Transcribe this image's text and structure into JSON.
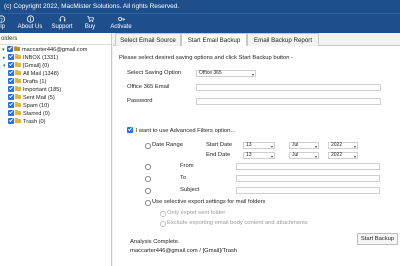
{
  "title": "(c) Copyright 2022, MacMister Solutions. All rights Reserved.",
  "toolbar": [
    {
      "label": "elp",
      "icon": "help-icon"
    },
    {
      "label": "About Us",
      "icon": "info-icon"
    },
    {
      "label": "Support",
      "icon": "support-icon"
    },
    {
      "label": "Buy",
      "icon": "cart-icon"
    },
    {
      "label": "Activate",
      "icon": "key-icon"
    }
  ],
  "sidebar": {
    "header": "olders",
    "account": "maccarter446@gmail.com",
    "items": [
      {
        "label": "INBOX (1331)",
        "expander": "▸"
      },
      {
        "label": "[Gmail] (0)",
        "expander": "▾"
      },
      {
        "label": "All Mail (1348)",
        "expander": ""
      },
      {
        "label": "Drafts (1)",
        "expander": ""
      },
      {
        "label": "Important (185)",
        "expander": ""
      },
      {
        "label": "Sent Mail (5)",
        "expander": ""
      },
      {
        "label": "Spam (10)",
        "expander": ""
      },
      {
        "label": "Starred (0)",
        "expander": ""
      },
      {
        "label": "Trash (0)",
        "expander": ""
      }
    ]
  },
  "tabs": [
    "Select Email Source",
    "Start Email Backup",
    "Email Backup Report"
  ],
  "active_tab": "Start Email Backup",
  "panel": {
    "instruction": "Please select desired saving options and click Start Backup button -",
    "saving_option_label": "Select Saving Option",
    "saving_option_value": "Office 365",
    "email_label": "Office 365 Email",
    "email_value": "",
    "password_label": "Password",
    "password_value": "",
    "advanced_label": "I want to use Advanced Filters option...",
    "date_range_label": "Date Range",
    "start_date_label": "Start Date",
    "end_date_label": "End Date",
    "start_date": {
      "day": "13",
      "month": "Jul",
      "year": "2022"
    },
    "end_date": {
      "day": "13",
      "month": "Jul",
      "year": "2022"
    },
    "from_label": "From",
    "to_label": "To",
    "subject_label": "Subject",
    "selective_label": "Use selective export settings for mail folders",
    "only_sent_label": "Only export sent folder",
    "exclude_sent_label": "Exclude exporting email body content and attachments",
    "status_line1": "Analysis Complete.",
    "status_line2": "maccarter446@gmail.com / [Gmail]/Trash",
    "start_button": "Start Backup"
  }
}
